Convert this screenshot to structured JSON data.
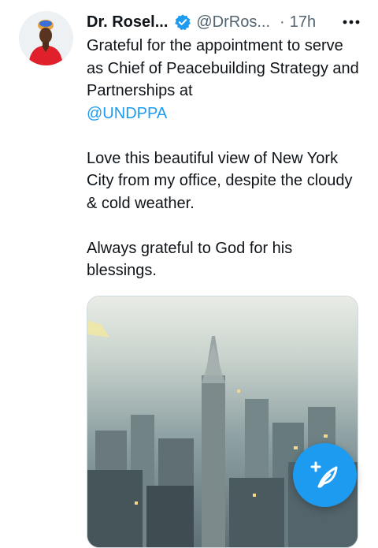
{
  "tweet": {
    "author": {
      "display_name": "Dr. Rosel...",
      "handle": "@DrRos...",
      "verified_icon": "verified-badge-icon"
    },
    "separator": "·",
    "time": "17h",
    "more_icon": "more-horizontal-icon",
    "text": {
      "line1": "Grateful for the appointment to serve as Chief of Peacebuilding Strategy and Partnerships at",
      "mention": "@UNDPPA",
      "paragraph2": "Love this beautiful view of New York City from my office, despite the cloudy & cold weather.",
      "paragraph3": "Always grateful to God for his blessings."
    },
    "media": {
      "icon": "city-photo"
    }
  },
  "compose_button": {
    "icon": "compose-tweet-icon"
  },
  "colors": {
    "accent": "#1d9bf0",
    "secondary_text": "#536471",
    "primary_text": "#0f1419"
  }
}
